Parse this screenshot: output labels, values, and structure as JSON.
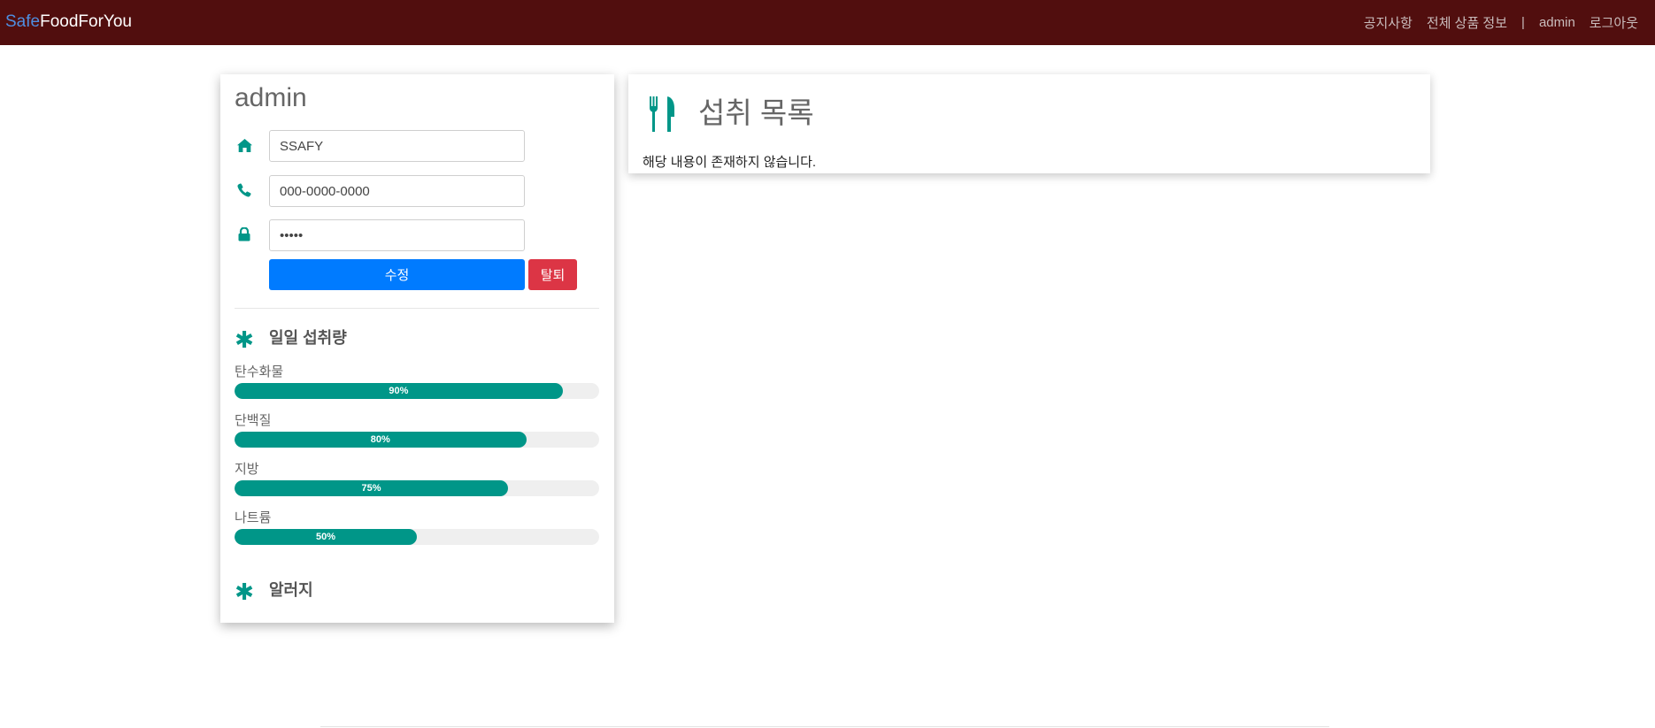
{
  "navbar": {
    "brand_safe": "Safe",
    "brand_rest": "FoodForYou",
    "links": {
      "notice": "공지사항",
      "products": "전체 상품 정보",
      "separator": "|",
      "user": "admin",
      "logout": "로그아웃"
    },
    "background_color": "#510e0e",
    "brand_accent_color": "#4f8ee0"
  },
  "profile": {
    "username": "admin",
    "address": {
      "icon": "home-icon",
      "value": "SSAFY"
    },
    "phone": {
      "icon": "phone-icon",
      "value": "000-0000-0000"
    },
    "password": {
      "icon": "lock-icon",
      "value": "•••••"
    },
    "edit_button": "수정",
    "delete_button": "탈퇴",
    "daily_intake": {
      "icon": "asterisk-icon",
      "title": "일일 섭취량",
      "items": [
        {
          "label": "탄수화물",
          "percent": 90,
          "percent_text": "90%"
        },
        {
          "label": "단백질",
          "percent": 80,
          "percent_text": "80%"
        },
        {
          "label": "지방",
          "percent": 75,
          "percent_text": "75%"
        },
        {
          "label": "나트륨",
          "percent": 50,
          "percent_text": "50%"
        }
      ]
    },
    "allergy": {
      "icon": "asterisk-icon",
      "title": "알러지"
    }
  },
  "intake_list": {
    "icon": "utensils-icon",
    "title": "섭취 목록",
    "empty_message": "해당 내용이 존재하지 않습니다."
  },
  "colors": {
    "primary": "#007bff",
    "danger": "#dc3545",
    "teal": "#009688"
  }
}
